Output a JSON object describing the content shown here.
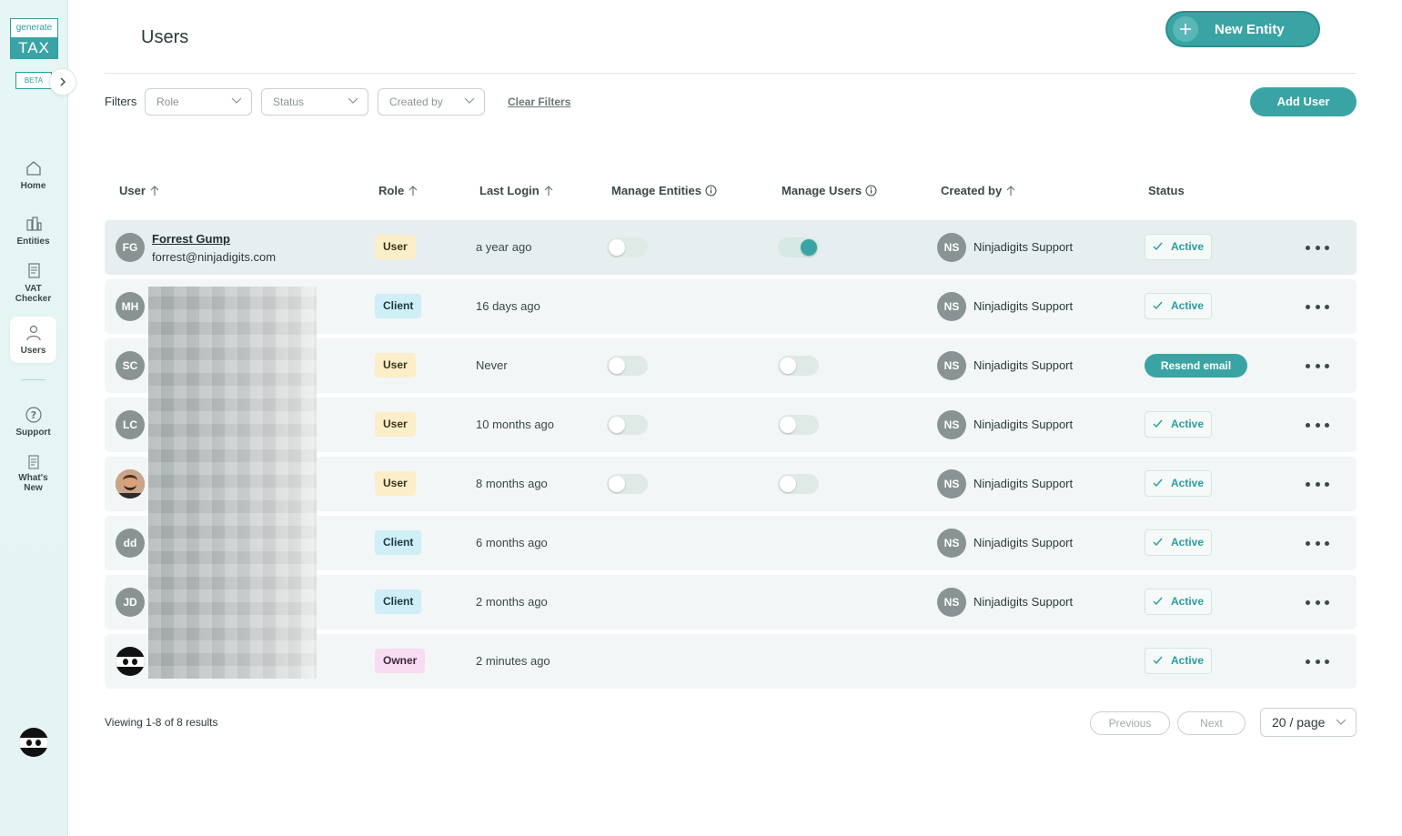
{
  "brand": {
    "logo_top": "generate",
    "logo_bottom": "TAX",
    "beta": "BETA"
  },
  "sidebar": {
    "items": [
      {
        "label": "Home"
      },
      {
        "label": "Entities"
      },
      {
        "label": "VAT Checker"
      },
      {
        "label": "Users"
      },
      {
        "label": "Support"
      },
      {
        "label": "What's New"
      }
    ]
  },
  "header": {
    "title": "Users",
    "new_entity": "New Entity"
  },
  "filters": {
    "label": "Filters",
    "role": "Role",
    "status": "Status",
    "created_by": "Created by",
    "clear": "Clear Filters",
    "add_user": "Add User"
  },
  "table": {
    "columns": {
      "user": "User",
      "role": "Role",
      "last_login": "Last Login",
      "manage_entities": "Manage Entities",
      "manage_users": "Manage Users",
      "created_by": "Created by",
      "status": "Status"
    },
    "rows": [
      {
        "initials": "FG",
        "name": "Forrest Gump",
        "email": "forrest@ninjadigits.com",
        "role": "User",
        "last_login": "a year ago",
        "manage_entities": false,
        "manage_users": true,
        "creator_initials": "NS",
        "creator": "Ninjadigits Support",
        "status": "Active"
      },
      {
        "initials": "MH",
        "role": "Client",
        "last_login": "16 days ago",
        "creator_initials": "NS",
        "creator": "Ninjadigits Support",
        "status": "Active"
      },
      {
        "initials": "SC",
        "role": "User",
        "last_login": "Never",
        "manage_entities": false,
        "manage_users": false,
        "creator_initials": "NS",
        "creator": "Ninjadigits Support",
        "status": "Resend email"
      },
      {
        "initials": "LC",
        "role": "User",
        "last_login": "10 months ago",
        "manage_entities": false,
        "manage_users": false,
        "creator_initials": "NS",
        "creator": "Ninjadigits Support",
        "status": "Active"
      },
      {
        "initials": "",
        "role": "User",
        "last_login": "8 months ago",
        "manage_entities": false,
        "manage_users": false,
        "creator_initials": "NS",
        "creator": "Ninjadigits Support",
        "status": "Active"
      },
      {
        "initials": "dd",
        "role": "Client",
        "last_login": "6 months ago",
        "creator_initials": "NS",
        "creator": "Ninjadigits Support",
        "status": "Active"
      },
      {
        "initials": "JD",
        "role": "Client",
        "last_login": "2 months ago",
        "creator_initials": "NS",
        "creator": "Ninjadigits Support",
        "status": "Active"
      },
      {
        "initials": "",
        "role": "Owner",
        "last_login": "2 minutes ago",
        "status": "Active"
      }
    ]
  },
  "footer": {
    "viewing": "Viewing 1-8 of 8 results",
    "previous": "Previous",
    "next": "Next",
    "per_page": "20 / page"
  },
  "colors": {
    "accent": "#3aa4a5",
    "sidebar_bg": "#e6f6f4"
  }
}
